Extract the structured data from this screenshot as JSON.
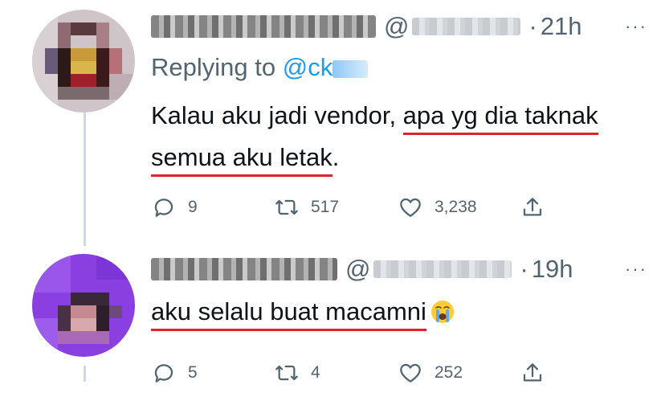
{
  "tweets": [
    {
      "at_symbol": "@",
      "time": "21h",
      "more": "···",
      "replying_prefix": "Replying to",
      "replying_handle": "@ck",
      "text_before": "Kalau aku jadi vendor, ",
      "text_underlined": "apa yg dia taknak semua aku letak",
      "text_after": ".",
      "replies": "9",
      "retweets": "517",
      "likes": "3,238"
    },
    {
      "at_symbol": "@",
      "time": "19h",
      "more": "···",
      "text_underlined": "aku selalu buat macamni",
      "emoji": "loudly-crying-face",
      "replies": "5",
      "retweets": "4",
      "likes": "252"
    }
  ],
  "icons": {
    "reply": "comment-icon",
    "retweet": "retweet-icon",
    "like": "heart-icon",
    "share": "share-icon"
  },
  "colors": {
    "text": "#0f1419",
    "secondary": "#536471",
    "link": "#1d9bf0",
    "underline": "#e0222f",
    "thread_line": "#cfd9de"
  }
}
